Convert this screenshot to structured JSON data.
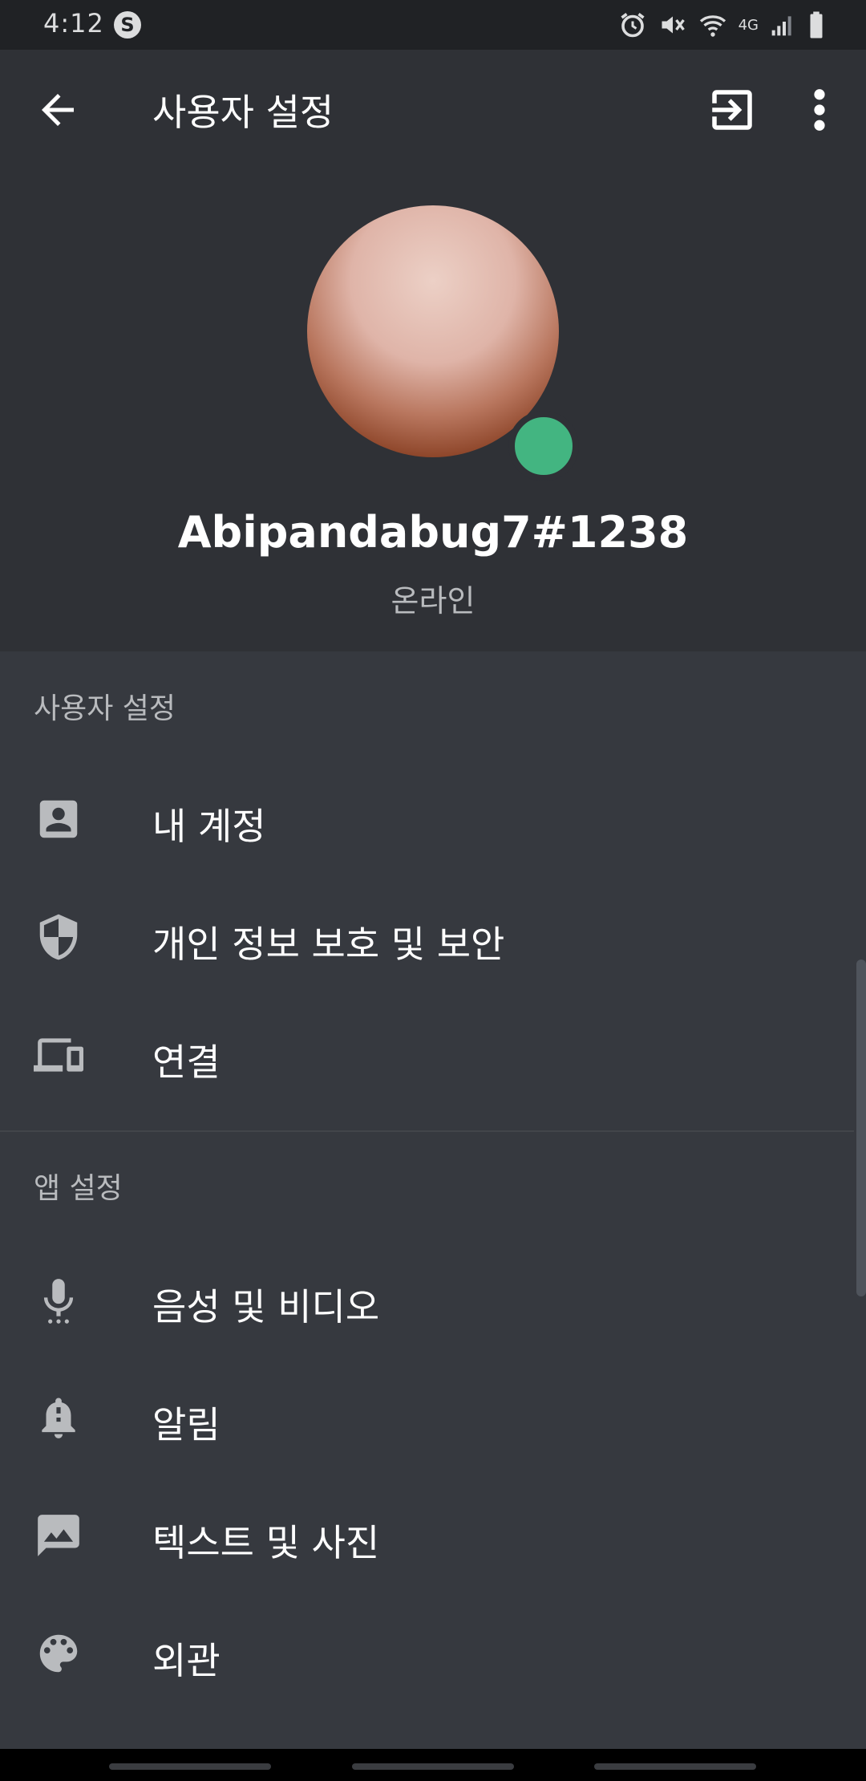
{
  "status_bar": {
    "time": "4:12",
    "app_badge": "S",
    "network": "4G",
    "icons": [
      "alarm-icon",
      "mute-icon",
      "wifi-icon",
      "signal-icon",
      "battery-icon"
    ]
  },
  "app_bar": {
    "title": "사용자 설정",
    "back_icon": "arrow-left-icon",
    "logout_icon": "logout-icon",
    "more_icon": "more-vert-icon"
  },
  "profile": {
    "username": "Abipandabug7#1238",
    "status": "온라인",
    "status_color": "#43b581"
  },
  "sections": {
    "user_settings": {
      "label": "사용자 설정",
      "items": [
        {
          "label": "내 계정",
          "icon": "account-icon"
        },
        {
          "label": "개인 정보 보호 및 보안",
          "icon": "shield-icon"
        },
        {
          "label": "연결",
          "icon": "devices-icon"
        }
      ]
    },
    "app_settings": {
      "label": "앱 설정",
      "items": [
        {
          "label": "음성 및 비디오",
          "icon": "microphone-icon"
        },
        {
          "label": "알림",
          "icon": "bell-icon"
        },
        {
          "label": "텍스트 및 사진",
          "icon": "image-icon"
        },
        {
          "label": "외관",
          "icon": "palette-icon"
        }
      ]
    }
  },
  "colors": {
    "background": "#36393f",
    "header": "#2f3136",
    "text_primary": "#ffffff",
    "text_muted": "#b9bbbe",
    "icon": "#b9bbbe",
    "online": "#43b581"
  }
}
